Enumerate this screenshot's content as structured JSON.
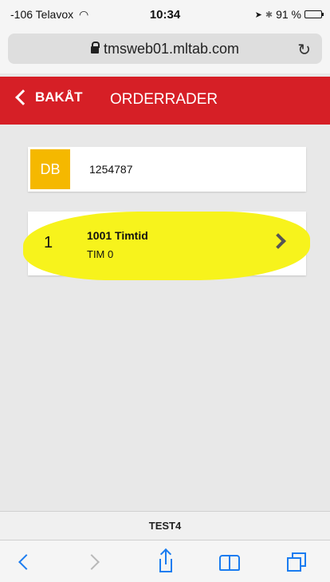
{
  "status_bar": {
    "carrier": "-106 Telavox",
    "time": "10:34",
    "battery": "91 %",
    "battery_level": 0.91,
    "icons": [
      "wifi-icon",
      "location-icon",
      "bluetooth-icon",
      "battery-icon"
    ]
  },
  "browser": {
    "url": "tmsweb01.mltab.com",
    "reload_icon": "reload-icon"
  },
  "header": {
    "back_label": "BAKÅT",
    "title": "ORDERRADER",
    "color": "#d61f26"
  },
  "order": {
    "badge": "DB",
    "badge_color": "#f5b800",
    "number": "1254787"
  },
  "rows": [
    {
      "num": "1",
      "title": "1001 Timtid",
      "subtitle": "TIM 0"
    }
  ],
  "footer": {
    "label": "TEST4"
  },
  "toolbar": {
    "icons": [
      "back-icon",
      "forward-icon",
      "share-icon",
      "bookmarks-icon",
      "tabs-icon"
    ],
    "accent": "#1a7cf0"
  }
}
